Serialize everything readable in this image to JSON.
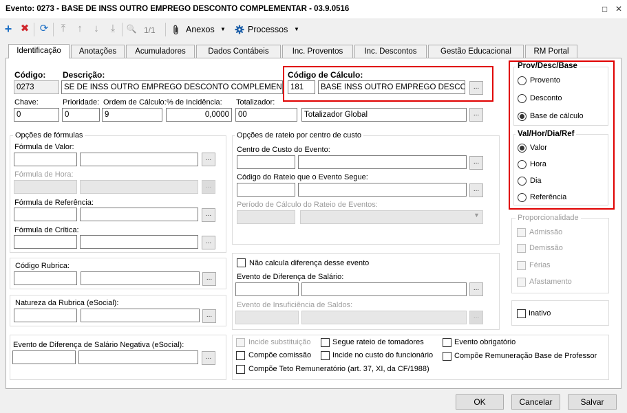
{
  "window": {
    "title": "Evento: 0273 - BASE DE INSS OUTRO EMPREGO DESCONTO COMPLEMENTAR - 03.9.0516",
    "restore_icon": "□",
    "close_icon": "✕"
  },
  "toolbar": {
    "add_icon": "+",
    "delete_icon": "✖",
    "refresh_icon": "⟳",
    "first_icon": "⤒",
    "up_icon": "↑",
    "down_icon": "↓",
    "last_icon": "⤓",
    "search_icon": "🔍",
    "record_count": "1/1",
    "anexos_label": "Anexos",
    "processos_label": "Processos",
    "dropdown_icon": "▼"
  },
  "tabs": [
    "Identificação",
    "Anotações",
    "Acumuladores",
    "Dados Contábeis",
    "Inc. Proventos",
    "Inc. Descontos",
    "Gestão Educacional",
    "RM Portal"
  ],
  "form": {
    "codigo_label": "Código:",
    "codigo_value": "0273",
    "descricao_label": "Descrição:",
    "descricao_value": "SE DE INSS OUTRO EMPREGO DESCONTO COMPLEMENTAR",
    "codigo_calculo_label": "Código de Cálculo:",
    "codigo_calculo_value": "181",
    "codigo_calculo_desc": "BASE INSS OUTRO EMPREGO DESCONT",
    "lookup_label": "...",
    "chave_label": "Chave:",
    "chave_value": "0",
    "prioridade_label": "Prioridade:",
    "prioridade_value": "0",
    "ordem_label": "Ordem de Cálculo:",
    "ordem_value": "9",
    "incidencia_label": "% de Incidência:",
    "incidencia_value": "0,0000",
    "totalizador_label": "Totalizador:",
    "totalizador_value": "00",
    "totalizador_desc": "Totalizador Global"
  },
  "formulas": {
    "group_label": "Opções de fórmulas",
    "valor_label": "Fórmula de Valor:",
    "hora_label": "Fórmula de Hora:",
    "referencia_label": "Fórmula de Referência:",
    "critica_label": "Fórmula de Crítica:"
  },
  "rateio": {
    "group_label": "Opções de rateio por centro de custo",
    "centro_label": "Centro de Custo do Evento:",
    "codigo_rateio_label": "Código do Rateio que o Evento Segue:",
    "periodo_label": "Período de Cálculo do Rateio de Eventos:"
  },
  "rubrica": {
    "codigo_label": "Código Rubrica:",
    "natureza_label": "Natureza da Rubrica (eSocial):",
    "evento_negativa_label": "Evento de Diferença de Salário Negativa (eSocial):"
  },
  "diferenca": {
    "nao_calcula_label": "Não calcula diferença desse evento",
    "evento_diferenca_label": "Evento de Diferença de Salário:",
    "evento_insuficiencia_label": "Evento de Insuficiência de Saldos:"
  },
  "checks": {
    "incide_substituicao": "Incide substituição",
    "segue_rateio": "Segue rateio de tomadores",
    "evento_obrigatorio": "Evento obrigatório",
    "compoe_comissao": "Compõe comissão",
    "incide_custo": "Incide no custo do funcionário",
    "compoe_remuneracao": "Compõe Remuneração Base de Professor",
    "compoe_teto": "Compõe Teto Remuneratório (art. 37, XI, da CF/1988)"
  },
  "prov_desc": {
    "group_label": "Prov/Desc/Base",
    "options": [
      "Provento",
      "Desconto",
      "Base de cálculo"
    ],
    "selected": "Base de cálculo"
  },
  "val_hora": {
    "group_label": "Val/Hor/Dia/Ref",
    "options": [
      "Valor",
      "Hora",
      "Dia",
      "Referência"
    ],
    "selected": "Valor"
  },
  "proporcionalidade": {
    "group_label": "Proporcionalidade",
    "options": [
      "Admissão",
      "Demissão",
      "Férias",
      "Afastamento"
    ]
  },
  "inativo_label": "Inativo",
  "footer": {
    "ok_label": "OK",
    "cancelar_label": "Cancelar",
    "salvar_label": "Salvar"
  },
  "colors": {
    "highlight": "#e00000",
    "toolbar_add": "#1d6fc4",
    "toolbar_delete": "#d0262c"
  }
}
